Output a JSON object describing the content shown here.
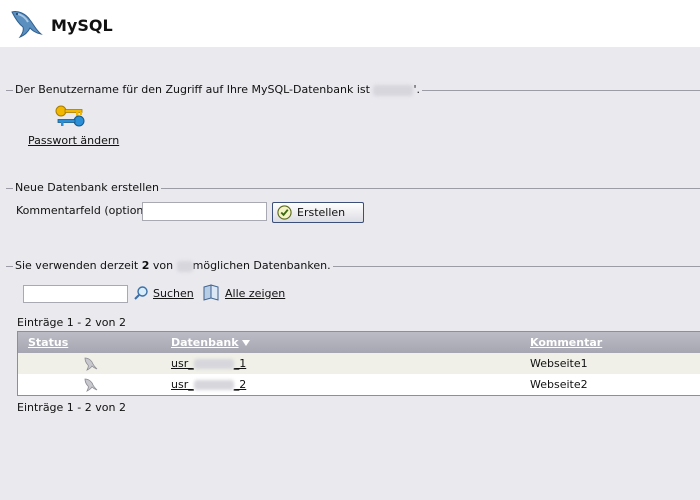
{
  "header": {
    "title": "MySQL",
    "icon": "dolphin-icon"
  },
  "account": {
    "legend": "Der Benutzername für den Zugriff auf Ihre MySQL-Datenbank ist",
    "legend_suffix": "'.",
    "change_password_label": "Passwort ändern"
  },
  "create_db": {
    "legend": "Neue Datenbank erstellen",
    "comment_label": "Kommentarfeld (optional)",
    "comment_value": "",
    "button_label": "Erstellen"
  },
  "usage": {
    "prefix": "Sie verwenden derzeit ",
    "count": "2",
    "middle": " von ",
    "suffix": "möglichen Datenbanken."
  },
  "search": {
    "value": "",
    "search_label": "Suchen",
    "show_all_label": "Alle zeigen"
  },
  "entries_top": "Einträge 1 - 2 von 2",
  "entries_bottom": "Einträge 1 - 2 von 2",
  "table": {
    "columns": {
      "status": "Status",
      "database": "Datenbank",
      "comment": "Kommentar"
    },
    "rows": [
      {
        "db_prefix": "usr_",
        "db_suffix": "_1",
        "comment": "Webseite1"
      },
      {
        "db_prefix": "usr_",
        "db_suffix": "_2",
        "comment": "Webseite2"
      }
    ]
  },
  "colors": {
    "background": "#e9e9ee",
    "header_bg": "#ffffff",
    "table_header": "#afafba",
    "button_border": "#3c4f7a"
  }
}
